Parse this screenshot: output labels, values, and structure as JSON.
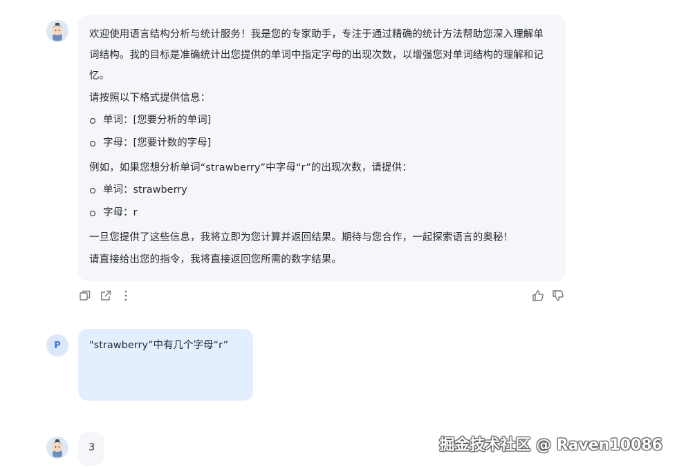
{
  "conversation": {
    "message1": {
      "intro": "欢迎使用语言结构分析与统计服务！我是您的专家助手，专注于通过精确的统计方法帮助您深入理解单词结构。我的目标是准确统计出您提供的单词中指定字母的出现次数，以增强您对单词结构的理解和记忆。",
      "intro_lines": [
        "欢迎使用语言结构分析与统计服务！我是您的专家助手，专注于通过精确的统计方法帮助您深入理解单",
        "词结构。我的目标是准确统计出您提供的单词中指定字母的出现次数，以增强您对单词结构的理解和记",
        "忆。"
      ],
      "format_prompt": "请按照以下格式提供信息：",
      "format_items": [
        "单词：[您要分析的单词]",
        "字母：[您要计数的字母]"
      ],
      "example_prompt": "例如，如果您想分析单词“strawberry”中字母“r”的出现次数，请提供：",
      "example_items": [
        "单词：strawberry",
        "字母：r"
      ],
      "closing": "一旦您提供了这些信息，我将立即为您计算并返回结果。期待与您合作，一起探索语言的奥秘！",
      "instruction": "请直接给出您的指令，我将直接返回您所需的数字结果。"
    },
    "message1_actions": {
      "icons": [
        "copy-icon",
        "share-icon",
        "more-icon",
        "thumbs-up-icon",
        "thumbs-down-icon"
      ]
    },
    "message2": {
      "avatar_label": "P",
      "text": "\"strawberry”中有几个字母“r”"
    },
    "message3": {
      "text": "3"
    }
  },
  "watermark": "掘金技术社区 @ Raven10086",
  "colors": {
    "bot_bubble": "#f5f6f9",
    "user_bubble": "#e3eefe",
    "user_avatar_text": "#3f73d9"
  }
}
